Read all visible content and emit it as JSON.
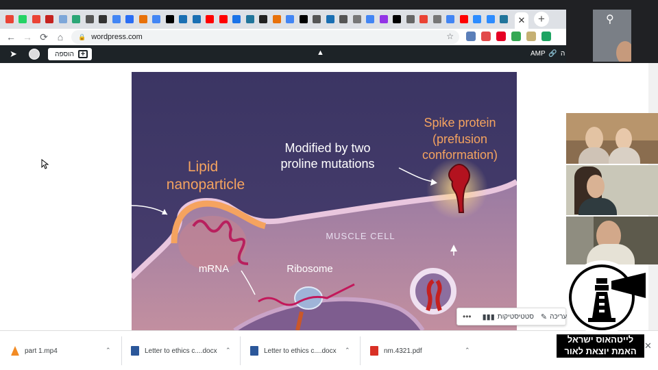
{
  "browser": {
    "url": "wordpress.com",
    "favicon_colors": [
      "#ea4335",
      "#25d366",
      "#ea4335",
      "#c5221f",
      "#7da7d9",
      "#2ba676",
      "#555555",
      "#333333",
      "#4285f4",
      "#2a6df4",
      "#e8710a",
      "#4285f4",
      "#000000",
      "#1a6fb3",
      "#1a6fb3",
      "#ff0000",
      "#ff0000",
      "#1a73e8",
      "#21759b",
      "#222222",
      "#e8710a",
      "#4285f4",
      "#000000",
      "#555555",
      "#1a6fb3",
      "#555555",
      "#777777",
      "#4285f4",
      "#9334e6",
      "#000000",
      "#666666",
      "#ea4335",
      "#777777",
      "#4285f4",
      "#ff0000",
      "#2d8cff",
      "#2d8cff",
      "#21759b"
    ],
    "extension_colors": [
      "#5b7fb9",
      "#e24a4a",
      "#e60023",
      "#34a853",
      "#c5b073",
      "#1da462"
    ]
  },
  "wp_admin": {
    "new_label": "הוספה",
    "amp_label": "AMP",
    "rtl_fragment": "ה"
  },
  "figure": {
    "label_lipid_1": "Lipid",
    "label_lipid_2": "nanoparticle",
    "label_mod_1": "Modified by two",
    "label_mod_2": "proline mutations",
    "label_spike_1": "Spike protein",
    "label_spike_2": "(prefusion",
    "label_spike_3": "conformation)",
    "label_muscle": "MUSCLE CELL",
    "label_mrna": "mRNA",
    "label_ribosome": "Ribosome"
  },
  "stats_bar": {
    "stats_label": "סטטיסטיקות",
    "edit_label": "עריכה"
  },
  "downloads": [
    {
      "name": "part 1.mp4",
      "color": "#f28b24"
    },
    {
      "name": "Letter to ethics c....docx",
      "color": "#2b579a"
    },
    {
      "name": "Letter to ethics c....docx",
      "color": "#2b579a"
    },
    {
      "name": "nm.4321.pdf",
      "color": "#d93025"
    }
  ],
  "logo": {
    "line1": "לייטהאוס ישראל",
    "line2": "האמת יוצאת לאור"
  }
}
